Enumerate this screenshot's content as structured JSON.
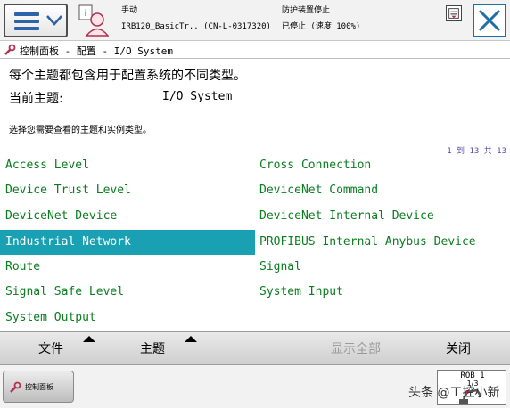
{
  "header": {
    "mode": "手动",
    "robot": "IRB120_BasicTr..  (CN-L-0317320)",
    "guard": "防护装置停止",
    "run_state": "已停止 (速度 100%)"
  },
  "titlebar": {
    "title": "控制面板 - 配置 - I/O System"
  },
  "description": {
    "text": "每个主题都包含用于配置系统的不同类型。",
    "current_topic_label": "当前主题:",
    "current_topic_value": "I/O System",
    "hint": "选择您需要查看的主题和实例类型。",
    "pager": "1 到 13 共 13"
  },
  "topics": {
    "left": [
      "Access Level",
      "Device Trust Level",
      "DeviceNet Device",
      "Industrial Network",
      "Route",
      "Signal Safe Level",
      "System Output"
    ],
    "right": [
      "Cross Connection",
      "DeviceNet Command",
      "DeviceNet Internal Device",
      "PROFIBUS Internal Anybus Device",
      "Signal",
      "System Input"
    ],
    "selected": "Industrial Network"
  },
  "toolbar": {
    "file": "文件",
    "topic": "主题",
    "show_all": "显示全部",
    "close": "关闭"
  },
  "taskbar": {
    "control_panel": "控制面板",
    "rob_label": "ROB_1",
    "rob_fraction": "1/3",
    "watermark": "头条 @工控小新"
  },
  "colors": {
    "selection": "#1aa0b3",
    "topic_text": "#0a7d1f",
    "pager_text": "#5a4aa8",
    "accent": "#1f6fa4"
  },
  "icons": {
    "menu": "hamburger-icon",
    "dropdown": "chevron-down-icon",
    "user": "user-info-icon",
    "quickset": "quickset-icon",
    "close": "close-icon",
    "control_panel": "wrench-icon",
    "robot": "robot-arm-icon"
  }
}
